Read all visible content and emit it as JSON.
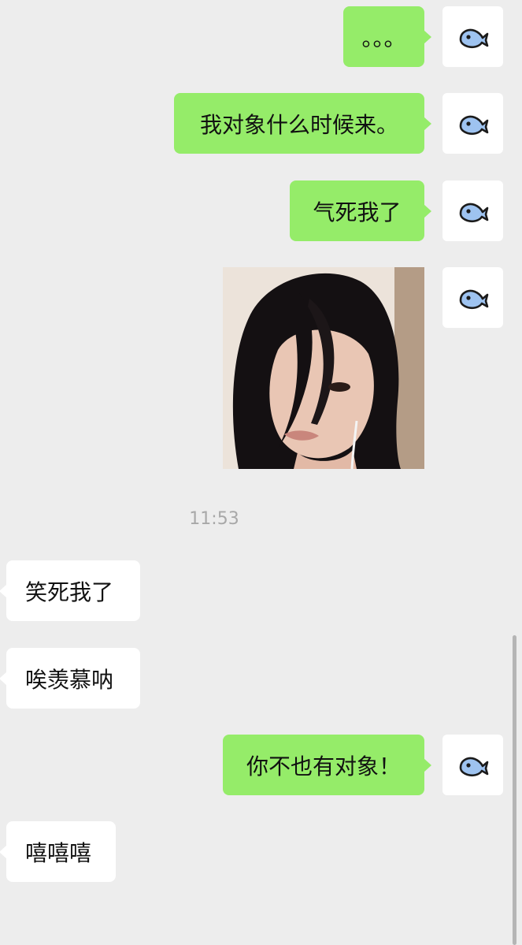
{
  "messages": [
    {
      "side": "me",
      "text": "。。。"
    },
    {
      "side": "me",
      "text": "我对象什么时候来。"
    },
    {
      "side": "me",
      "text": "气死我了"
    },
    {
      "side": "me",
      "type": "image",
      "image": "selfie-photo"
    },
    {
      "side": "other",
      "text": "笑死我了"
    },
    {
      "side": "other",
      "text": "唉羡慕呐"
    },
    {
      "side": "me",
      "text": "你不也有对象！"
    },
    {
      "side": "other",
      "text": "嘻嘻嘻"
    }
  ],
  "timestamp": "11:53",
  "avatar_icon": "fish-icon",
  "colors": {
    "background": "#ededed",
    "my_bubble": "#95ec69",
    "other_bubble": "#ffffff",
    "timestamp_text": "#a8a8a8"
  }
}
